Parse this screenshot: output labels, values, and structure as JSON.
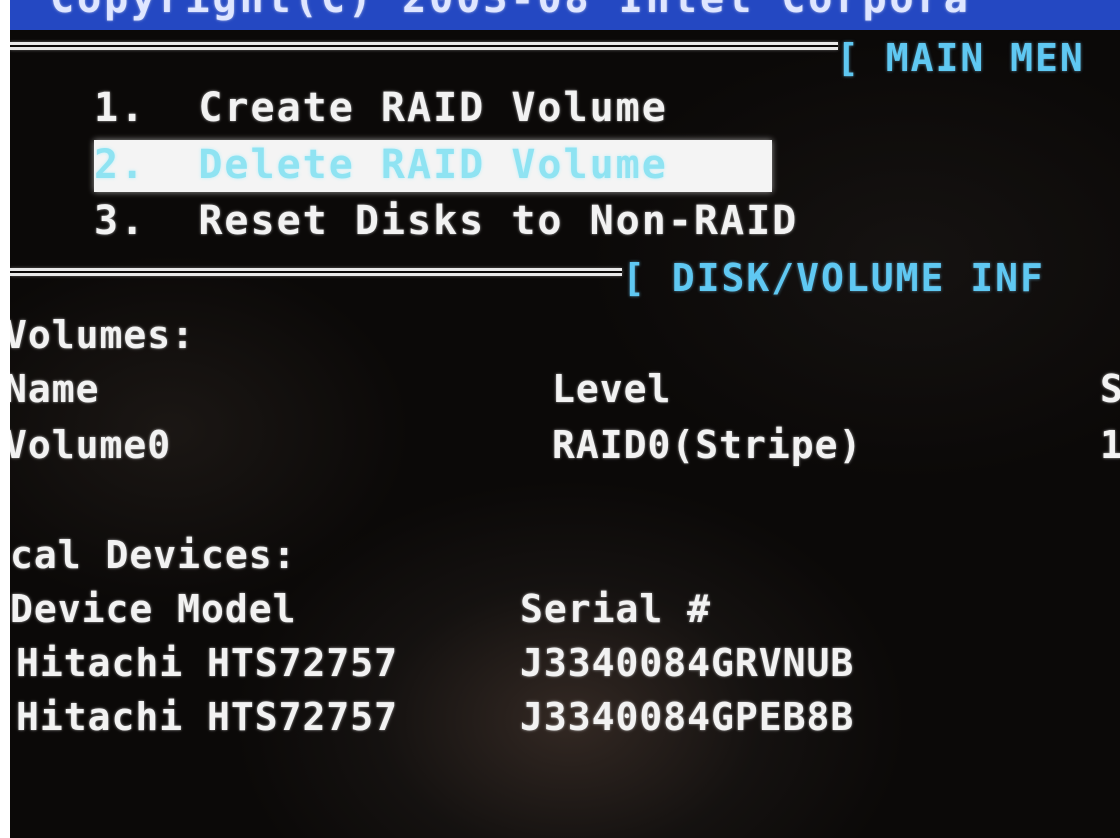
{
  "top_bar": {
    "copyright_partial": "Copyright(C) 2003-08 Intel Corpora"
  },
  "main_menu": {
    "header": "[ MAIN MEN",
    "items": [
      {
        "number": "1.",
        "label": "Create RAID Volume"
      },
      {
        "number": "2.",
        "label": "Delete RAID Volume"
      },
      {
        "number": "3.",
        "label": "Reset Disks to Non-RAID"
      }
    ],
    "selected_index": 1
  },
  "disk_info": {
    "header": "[ DISK/VOLUME INF",
    "volumes": {
      "title": "Volumes:",
      "columns": [
        "Name",
        "Level",
        "S"
      ],
      "rows": [
        {
          "name": "Volume0",
          "level": "RAID0(Stripe)",
          "size": "1"
        }
      ]
    },
    "devices": {
      "title": "cal Devices:",
      "columns": [
        "Device Model",
        "Serial #"
      ],
      "rows": [
        {
          "model": "Hitachi HTS72757",
          "serial": "J3340084GRVNUB"
        },
        {
          "model": "Hitachi HTS72757",
          "serial": "J3340084GPEB8B"
        }
      ]
    }
  },
  "colors": {
    "background": "#0b0908",
    "text": "#f2f2f2",
    "header_accent": "#5fc8f2",
    "top_bar": "#2448c2",
    "selection_bg": "#f4f4f4",
    "selection_text": "#8fe3f2"
  }
}
